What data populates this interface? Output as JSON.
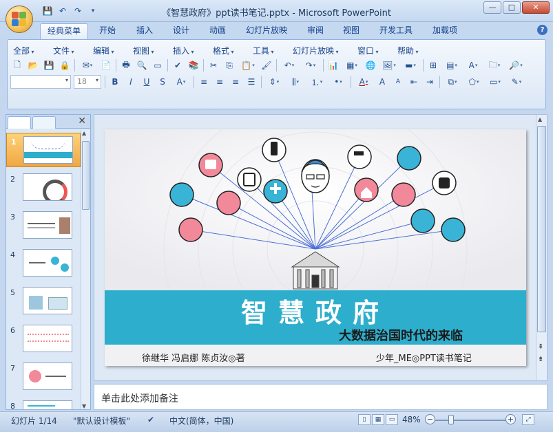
{
  "window": {
    "title": "《智慧政府》ppt读书笔记.pptx - Microsoft PowerPoint",
    "minimize": "—",
    "maximize": "□",
    "close": "✕"
  },
  "ribbon_tabs": [
    "经典菜单",
    "开始",
    "插入",
    "设计",
    "动画",
    "幻灯片放映",
    "审阅",
    "视图",
    "开发工具",
    "加载项"
  ],
  "help_label": "?",
  "menus": [
    "全部",
    "文件",
    "编辑",
    "视图",
    "插入",
    "格式",
    "工具",
    "幻灯片放映",
    "窗口",
    "帮助"
  ],
  "font_size": "18",
  "format_buttons": [
    "B",
    "I",
    "U",
    "S",
    "A"
  ],
  "slides_count_shown": [
    "1",
    "2",
    "3",
    "4",
    "5",
    "6",
    "7",
    "8"
  ],
  "slide": {
    "title": "智慧政府",
    "subtitle": "大数据治国时代的来临",
    "authors": "徐继华 冯启娜 陈贞汝◎著",
    "credit": "少年_ME◎PPT读书笔记"
  },
  "notes_placeholder": "单击此处添加备注",
  "status": {
    "slide_info": "幻灯片 1/14",
    "theme": "\"默认设计模板\"",
    "language": "中文(简体，中国)",
    "zoom": "48%"
  },
  "zoom_level": 0.48,
  "colors": {
    "banner": "#2eaecd",
    "accent_pink": "#f2899b",
    "accent_blue": "#39b4d6",
    "line": "#4a6fd6"
  }
}
